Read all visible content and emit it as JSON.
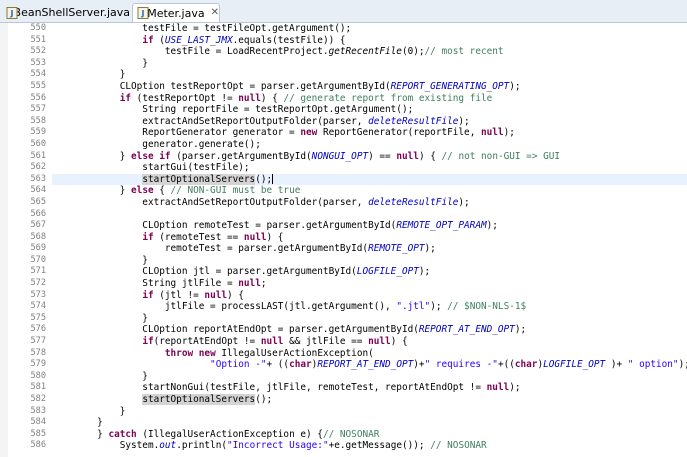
{
  "tabs": [
    {
      "label": "BeanShellServer.java",
      "active": false,
      "icon": "java-file-icon"
    },
    {
      "label": "JMeter.java",
      "active": true,
      "icon": "java-file-icon",
      "close": "✕"
    }
  ],
  "colors": {
    "keyword": "#7f0055",
    "comment": "#3f7f5f",
    "string": "#2a00ff",
    "constant": "#0000c0",
    "current_line": "#e8f2fe"
  },
  "editor": {
    "current_line": "563",
    "lines": [
      {
        "n": "550",
        "tokens": [
          {
            "t": "                testFile = testFileOpt.getArgument();"
          }
        ]
      },
      {
        "n": "551",
        "tokens": [
          {
            "t": "                "
          },
          {
            "t": "if",
            "c": "kw"
          },
          {
            "t": " ("
          },
          {
            "t": "USE_LAST_JMX",
            "c": "it"
          },
          {
            "t": ".equals(testFile)) {"
          }
        ]
      },
      {
        "n": "552",
        "tokens": [
          {
            "t": "                    testFile = LoadRecentProject."
          },
          {
            "t": "getRecentFile",
            "c": "itm"
          },
          {
            "t": "(0);"
          },
          {
            "t": "// most recent",
            "c": "cm"
          }
        ]
      },
      {
        "n": "553",
        "tokens": [
          {
            "t": "                }"
          }
        ]
      },
      {
        "n": "554",
        "tokens": [
          {
            "t": "            }"
          }
        ]
      },
      {
        "n": "555",
        "tokens": [
          {
            "t": "            CLOption testReportOpt = parser.getArgumentById("
          },
          {
            "t": "REPORT_GENERATING_OPT",
            "c": "it"
          },
          {
            "t": ");"
          }
        ]
      },
      {
        "n": "556",
        "tokens": [
          {
            "t": "            "
          },
          {
            "t": "if",
            "c": "kw"
          },
          {
            "t": " (testReportOpt != "
          },
          {
            "t": "null",
            "c": "kw"
          },
          {
            "t": ") { "
          },
          {
            "t": "// generate report from existing file",
            "c": "cm"
          }
        ]
      },
      {
        "n": "557",
        "tokens": [
          {
            "t": "                String reportFile = testReportOpt.getArgument();"
          }
        ]
      },
      {
        "n": "558",
        "tokens": [
          {
            "t": "                extractAndSetReportOutputFolder(parser, "
          },
          {
            "t": "deleteResultFile",
            "c": "it"
          },
          {
            "t": ");"
          }
        ]
      },
      {
        "n": "559",
        "tokens": [
          {
            "t": "                ReportGenerator generator = "
          },
          {
            "t": "new",
            "c": "kw"
          },
          {
            "t": " ReportGenerator(reportFile, "
          },
          {
            "t": "null",
            "c": "kw"
          },
          {
            "t": ");"
          }
        ]
      },
      {
        "n": "560",
        "tokens": [
          {
            "t": "                generator.generate();"
          }
        ]
      },
      {
        "n": "561",
        "tokens": [
          {
            "t": "            } "
          },
          {
            "t": "else",
            "c": "kw"
          },
          {
            "t": " "
          },
          {
            "t": "if",
            "c": "kw"
          },
          {
            "t": " (parser.getArgumentById("
          },
          {
            "t": "NONGUI_OPT",
            "c": "it"
          },
          {
            "t": ") == "
          },
          {
            "t": "null",
            "c": "kw"
          },
          {
            "t": ") { "
          },
          {
            "t": "// not non-GUI => GUI",
            "c": "cm"
          }
        ]
      },
      {
        "n": "562",
        "tokens": [
          {
            "t": "                startGui(testFile);"
          }
        ]
      },
      {
        "n": "563",
        "tokens": [
          {
            "t": "                "
          },
          {
            "t": "startOptionalServers",
            "c": "hl"
          },
          {
            "t": "();"
          },
          {
            "caret": true
          }
        ]
      },
      {
        "n": "564",
        "tokens": [
          {
            "t": "            } "
          },
          {
            "t": "else",
            "c": "kw"
          },
          {
            "t": " { "
          },
          {
            "t": "// NON-GUI must be true",
            "c": "cm"
          }
        ]
      },
      {
        "n": "565",
        "tokens": [
          {
            "t": "                extractAndSetReportOutputFolder(parser, "
          },
          {
            "t": "deleteResultFile",
            "c": "it"
          },
          {
            "t": ");"
          }
        ]
      },
      {
        "n": "566",
        "tokens": [
          {
            "t": ""
          }
        ]
      },
      {
        "n": "567",
        "tokens": [
          {
            "t": "                CLOption remoteTest = parser.getArgumentById("
          },
          {
            "t": "REMOTE_OPT_PARAM",
            "c": "it"
          },
          {
            "t": ");"
          }
        ]
      },
      {
        "n": "568",
        "tokens": [
          {
            "t": "                "
          },
          {
            "t": "if",
            "c": "kw"
          },
          {
            "t": " (remoteTest == "
          },
          {
            "t": "null",
            "c": "kw"
          },
          {
            "t": ") {"
          }
        ]
      },
      {
        "n": "569",
        "tokens": [
          {
            "t": "                    remoteTest = parser.getArgumentById("
          },
          {
            "t": "REMOTE_OPT",
            "c": "it"
          },
          {
            "t": ");"
          }
        ]
      },
      {
        "n": "570",
        "tokens": [
          {
            "t": "                }"
          }
        ]
      },
      {
        "n": "571",
        "tokens": [
          {
            "t": "                CLOption jtl = parser.getArgumentById("
          },
          {
            "t": "LOGFILE_OPT",
            "c": "it"
          },
          {
            "t": ");"
          }
        ]
      },
      {
        "n": "572",
        "tokens": [
          {
            "t": "                String jtlFile = "
          },
          {
            "t": "null",
            "c": "kw"
          },
          {
            "t": ";"
          }
        ]
      },
      {
        "n": "573",
        "tokens": [
          {
            "t": "                "
          },
          {
            "t": "if",
            "c": "kw"
          },
          {
            "t": " (jtl != "
          },
          {
            "t": "null",
            "c": "kw"
          },
          {
            "t": ") {"
          }
        ]
      },
      {
        "n": "574",
        "tokens": [
          {
            "t": "                    jtlFile = processLAST(jtl.getArgument(), "
          },
          {
            "t": "\".jtl\"",
            "c": "str"
          },
          {
            "t": "); "
          },
          {
            "t": "// $NON-NLS-1$",
            "c": "cm"
          }
        ]
      },
      {
        "n": "575",
        "tokens": [
          {
            "t": "                }"
          }
        ]
      },
      {
        "n": "576",
        "tokens": [
          {
            "t": "                CLOption reportAtEndOpt = parser.getArgumentById("
          },
          {
            "t": "REPORT_AT_END_OPT",
            "c": "it"
          },
          {
            "t": ");"
          }
        ]
      },
      {
        "n": "577",
        "tokens": [
          {
            "t": "                "
          },
          {
            "t": "if",
            "c": "kw"
          },
          {
            "t": "(reportAtEndOpt != "
          },
          {
            "t": "null",
            "c": "kw"
          },
          {
            "t": " && jtlFile == "
          },
          {
            "t": "null",
            "c": "kw"
          },
          {
            "t": ") {"
          }
        ]
      },
      {
        "n": "578",
        "tokens": [
          {
            "t": "                    "
          },
          {
            "t": "throw",
            "c": "kw"
          },
          {
            "t": " "
          },
          {
            "t": "new",
            "c": "kw"
          },
          {
            "t": " IllegalUserActionException("
          }
        ]
      },
      {
        "n": "579",
        "tokens": [
          {
            "t": "                            "
          },
          {
            "t": "\"Option -\"",
            "c": "str"
          },
          {
            "t": "+ (("
          },
          {
            "t": "char",
            "c": "kw"
          },
          {
            "t": ")"
          },
          {
            "t": "REPORT_AT_END_OPT",
            "c": "it"
          },
          {
            "t": ")+"
          },
          {
            "t": "\" requires -\"",
            "c": "str"
          },
          {
            "t": "+(("
          },
          {
            "t": "char",
            "c": "kw"
          },
          {
            "t": ")"
          },
          {
            "t": "LOGFILE_OPT",
            "c": "it"
          },
          {
            "t": " )+ "
          },
          {
            "t": "\" option\"",
            "c": "str"
          },
          {
            "t": ");"
          }
        ]
      },
      {
        "n": "580",
        "tokens": [
          {
            "t": "                }"
          }
        ]
      },
      {
        "n": "581",
        "tokens": [
          {
            "t": "                startNonGui(testFile, jtlFile, remoteTest, reportAtEndOpt != "
          },
          {
            "t": "null",
            "c": "kw"
          },
          {
            "t": ");"
          }
        ]
      },
      {
        "n": "582",
        "tokens": [
          {
            "t": "                "
          },
          {
            "t": "startOptionalServers",
            "c": "hl"
          },
          {
            "t": "();"
          }
        ]
      },
      {
        "n": "583",
        "tokens": [
          {
            "t": "            }"
          }
        ]
      },
      {
        "n": "584",
        "tokens": [
          {
            "t": "        }"
          }
        ]
      },
      {
        "n": "585",
        "tokens": [
          {
            "t": "        } "
          },
          {
            "t": "catch",
            "c": "kw"
          },
          {
            "t": " (IllegalUserActionException e) {"
          },
          {
            "t": "// NOSONAR",
            "c": "cm"
          }
        ]
      },
      {
        "n": "586",
        "tokens": [
          {
            "t": "            System."
          },
          {
            "t": "out",
            "c": "it"
          },
          {
            "t": ".println("
          },
          {
            "t": "\"Incorrect Usage:\"",
            "c": "str"
          },
          {
            "t": "+e.getMessage()); "
          },
          {
            "t": "// NOSONAR",
            "c": "cm"
          }
        ]
      }
    ]
  }
}
